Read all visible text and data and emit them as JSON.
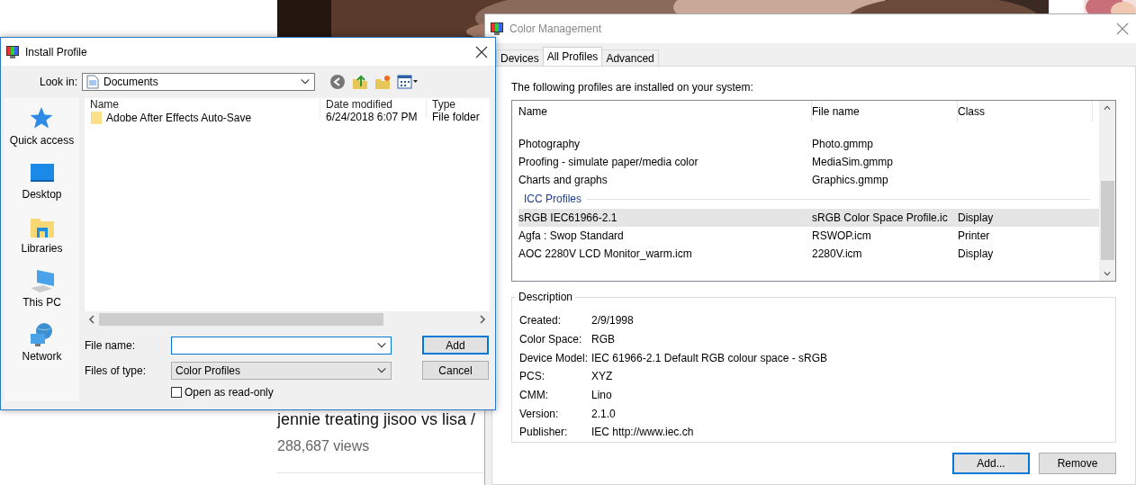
{
  "web_page": {
    "video_title": "jennie treating jisoo vs lisa /",
    "views": "288,687 views"
  },
  "install_profile": {
    "title": "Install Profile",
    "look_in_label": "Look in:",
    "look_in_value": "Documents",
    "places": [
      {
        "label": "Quick access",
        "kind": "star"
      },
      {
        "label": "Desktop",
        "kind": "desktop"
      },
      {
        "label": "Libraries",
        "kind": "libraries"
      },
      {
        "label": "This PC",
        "kind": "pc"
      },
      {
        "label": "Network",
        "kind": "network"
      }
    ],
    "columns": [
      "Name",
      "Date modified",
      "Type"
    ],
    "rows": [
      {
        "name": "Adobe After Effects Auto-Save",
        "date_modified": "6/24/2018 6:07 PM",
        "type": "File folder"
      }
    ],
    "file_name_label": "File name:",
    "files_of_type_label": "Files of type:",
    "files_of_type_value": "Color Profiles",
    "read_only": {
      "label": "Open as read-only",
      "checked": false
    },
    "buttons": [
      {
        "label": "Add",
        "default": true
      },
      {
        "label": "Cancel",
        "default": false
      }
    ]
  },
  "color_management": {
    "title": "Color Management",
    "tabs": [
      {
        "label": "Devices",
        "selected": false
      },
      {
        "label": "All Profiles",
        "selected": true
      },
      {
        "label": "Advanced",
        "selected": false
      }
    ],
    "intro": "The following profiles are installed on your system:",
    "columns": [
      "Name",
      "File name",
      "Class"
    ],
    "rows": [
      {
        "kind": "profile",
        "name": "Photography",
        "file_name": "Photo.gmmp",
        "selected": false
      },
      {
        "kind": "profile",
        "name": "Proofing - simulate paper/media color",
        "file_name": "MediaSim.gmmp",
        "selected": false
      },
      {
        "kind": "profile",
        "name": "Charts and graphs",
        "file_name": "Graphics.gmmp",
        "selected": false
      },
      {
        "kind": "group",
        "name": "ICC Profiles"
      },
      {
        "kind": "profile",
        "name": "sRGB IEC61966-2.1",
        "file_name": "sRGB Color Space Profile.ic",
        "class": "Display",
        "selected": true
      },
      {
        "kind": "profile",
        "name": "Agfa : Swop Standard",
        "file_name": "RSWOP.icm",
        "class": "Printer",
        "selected": false
      },
      {
        "kind": "profile",
        "name": "AOC 2280V LCD Monitor_warm.icm",
        "file_name": "2280V.icm",
        "class": "Display",
        "selected": false
      }
    ],
    "description": {
      "legend": "Description",
      "fields": [
        {
          "label": "Created:",
          "value": "2/9/1998"
        },
        {
          "label": "Color Space:",
          "value": "RGB"
        },
        {
          "label": "Device Model:",
          "value": "IEC 61966-2.1 Default RGB colour space - sRGB"
        },
        {
          "label": "PCS:",
          "value": "XYZ"
        },
        {
          "label": "CMM:",
          "value": "Lino"
        },
        {
          "label": "Version:",
          "value": "2.1.0"
        },
        {
          "label": "Publisher:",
          "value": "IEC http://www.iec.ch"
        }
      ]
    },
    "buttons": [
      {
        "label": "Add...",
        "default": true
      },
      {
        "label": "Remove",
        "default": false
      }
    ]
  }
}
